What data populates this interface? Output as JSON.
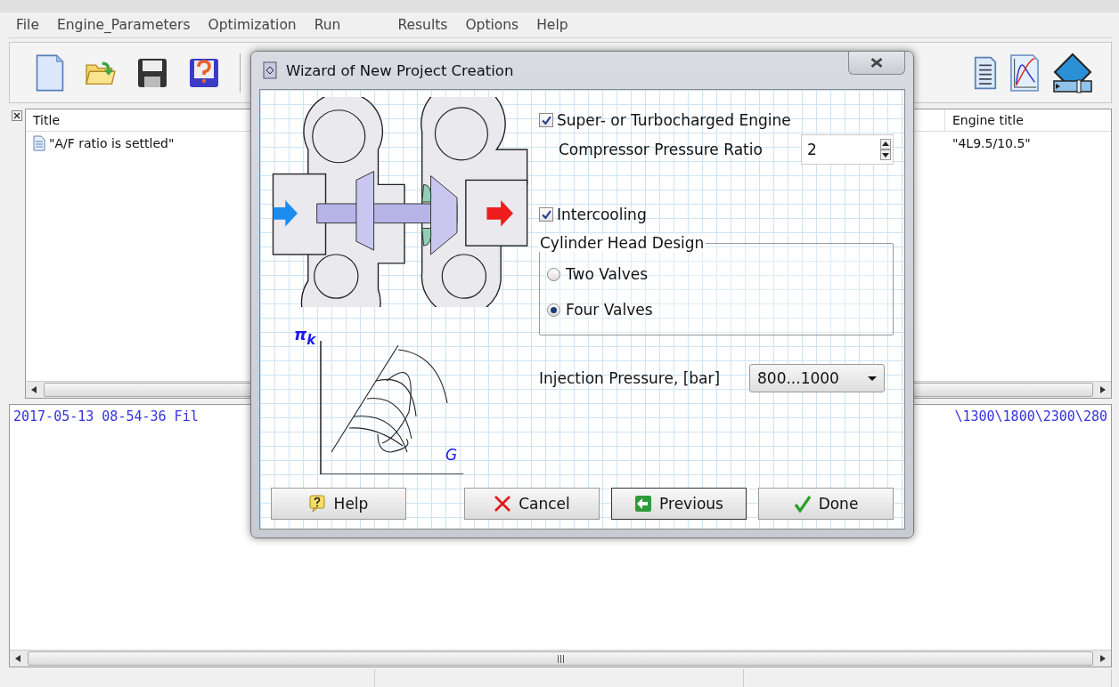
{
  "menu": [
    "File",
    "Engine_Parameters",
    "Optimization",
    "Run",
    "Results",
    "Options",
    "Help"
  ],
  "list": {
    "columns": [
      "Title",
      "Engine title"
    ],
    "rows": [
      {
        "title": "\"A/F ratio is settled\"",
        "engine_title": "\"4L9.5/10.5\""
      }
    ]
  },
  "log": {
    "lines": [
      {
        "start": "2017-05-13 08-54-36 Fil",
        "end": "\\1300\\1800\\2300\\280"
      }
    ]
  },
  "dialog": {
    "title": "Wizard of New Project Creation",
    "map_labels": {
      "y": "π$_{k}$",
      "x": "G"
    },
    "supercharged": {
      "label": "Super- or Turbocharged Engine",
      "checked": true
    },
    "pressure_ratio": {
      "label": "Compressor Pressure Ratio",
      "value": "2"
    },
    "intercooling": {
      "label": "Intercooling",
      "checked": true
    },
    "cylinder_head": {
      "title": "Cylinder Head Design",
      "options": [
        {
          "label": "Two Valves",
          "selected": false
        },
        {
          "label": "Four Valves",
          "selected": true
        }
      ]
    },
    "injection": {
      "label": "Injection Pressure, [bar]",
      "value": "800...1000"
    },
    "buttons": [
      {
        "label": "Help",
        "kind": "help"
      },
      {
        "label": "Cancel",
        "kind": "cancel"
      },
      {
        "label": "Previous",
        "kind": "previous"
      },
      {
        "label": "Done",
        "kind": "done"
      }
    ]
  }
}
